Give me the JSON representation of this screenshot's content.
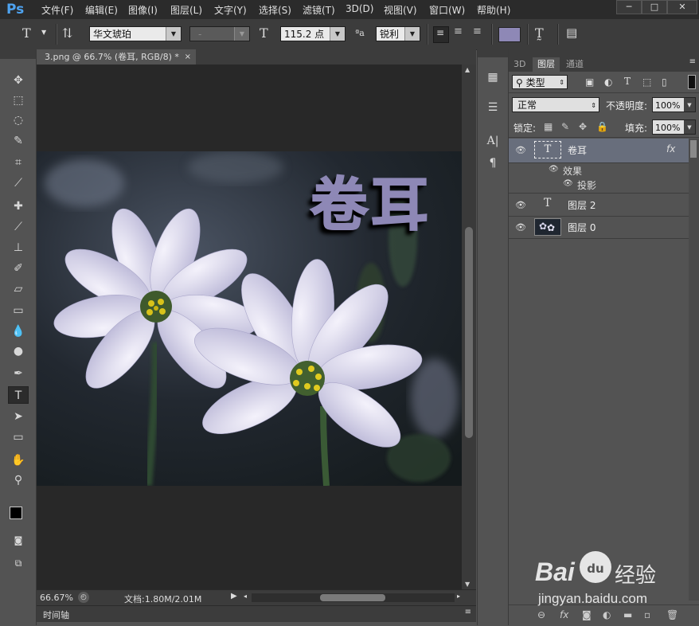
{
  "app": {
    "logo": "Ps"
  },
  "menu": [
    "文件(F)",
    "编辑(E)",
    "图像(I)",
    "图层(L)",
    "文字(Y)",
    "选择(S)",
    "滤镜(T)",
    "3D(D)",
    "视图(V)",
    "窗口(W)",
    "帮助(H)"
  ],
  "window_controls": {
    "minimize": "─",
    "maximize": "□",
    "close": "✕"
  },
  "options": {
    "font_family": "华文琥珀",
    "font_style": "-",
    "font_size": "115.2 点",
    "aa_label": "ªa",
    "antialias": "锐利",
    "text_color": "#8e88b6"
  },
  "document": {
    "tab_title": "3.png @ 66.7% (卷耳, RGB/8) *",
    "canvas_text": "卷耳",
    "zoom": "66.67%",
    "doc_size": "文档:1.80M/2.01M",
    "timeline_label": "时间轴"
  },
  "layers_panel": {
    "tabs": [
      "3D",
      "图层",
      "通道"
    ],
    "filter_label": "类型",
    "blend_mode": "正常",
    "opacity_label": "不透明度:",
    "opacity": "100%",
    "lock_label": "锁定:",
    "fill_label": "填充:",
    "fill": "100%",
    "layers": [
      {
        "name": "卷耳",
        "badge": "fx",
        "selected": true
      },
      {
        "name": "效果"
      },
      {
        "name": "投影"
      },
      {
        "name": "图层 2"
      },
      {
        "name": "图层 0"
      }
    ]
  },
  "watermark": {
    "brand": "Bai",
    "paw": "du",
    "cn": "经验",
    "url": "jingyan.baidu.com"
  }
}
